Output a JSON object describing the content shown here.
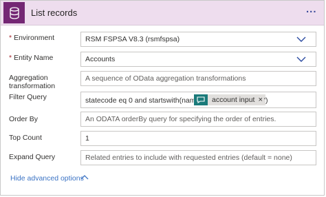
{
  "header": {
    "title": "List records",
    "icon": "database-icon",
    "more_label": "..."
  },
  "fields": {
    "environment": {
      "label": "Environment",
      "required": "*",
      "value": "RSM FSPSA V8.3 (rsmfspsa)"
    },
    "entity_name": {
      "label": "Entity Name",
      "required": "*",
      "value": "Accounts"
    },
    "aggregation": {
      "label_line1": "Aggregation",
      "label_line2": "transformation",
      "placeholder": "A sequence of OData aggregation transformations"
    },
    "filter_query": {
      "label": "Filter Query",
      "value_before": "statecode eq 0 and startswith(name, '",
      "token": {
        "label": "account input",
        "close": "×",
        "icon": "dynamic-content-icon"
      },
      "value_after": "')"
    },
    "order_by": {
      "label": "Order By",
      "placeholder": "An ODATA orderBy query for specifying the order of entries."
    },
    "top_count": {
      "label": "Top Count",
      "value": "1"
    },
    "expand_query": {
      "label": "Expand Query",
      "placeholder": "Related entries to include with requested entries (default = none)"
    }
  },
  "footer": {
    "hide_advanced_label": "Hide advanced options"
  },
  "colors": {
    "header_bg": "#eeddee",
    "icon_bg": "#742774",
    "link": "#3b73c4",
    "token_icon_bg": "#1a7a7a"
  }
}
